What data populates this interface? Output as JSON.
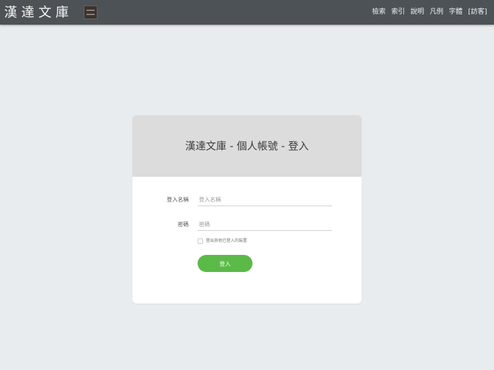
{
  "header": {
    "logo_text": "漢達文庫",
    "nav_links": [
      "檢索",
      "索引",
      "說明",
      "凡例",
      "字體",
      "[訪客]"
    ]
  },
  "login": {
    "title": "漢達文庫 - 個人帳號 - 登入",
    "username_label": "登入名稱",
    "username_placeholder": "登入名稱",
    "password_label": "密碼",
    "password_placeholder": "密碼",
    "logout_others_label": "登出其他已登入的裝置",
    "submit_label": "登入"
  },
  "colors": {
    "navbar": "#4d5257",
    "background": "#e9ecee",
    "button": "#5bba47"
  }
}
